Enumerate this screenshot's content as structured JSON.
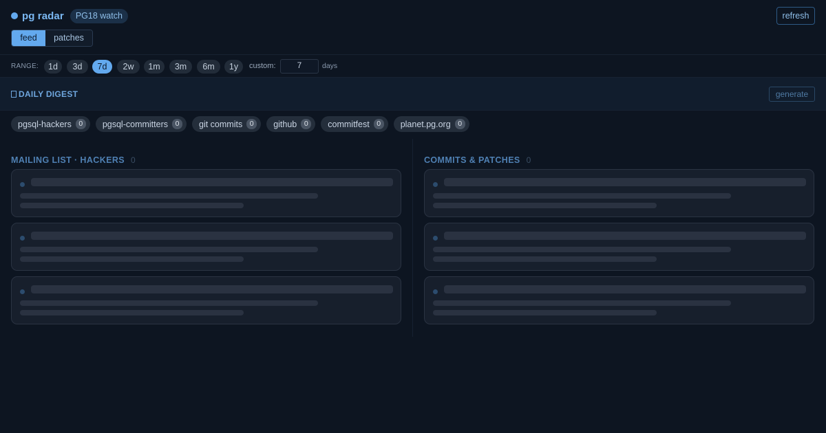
{
  "header": {
    "title": "pg radar",
    "badge": "PG18 watch",
    "refresh_label": "refresh",
    "tabs": [
      {
        "label": "feed",
        "active": true
      },
      {
        "label": "patches",
        "active": false
      }
    ]
  },
  "range": {
    "label": "RANGE:",
    "options": [
      {
        "label": "1d",
        "active": false
      },
      {
        "label": "3d",
        "active": false
      },
      {
        "label": "7d",
        "active": true
      },
      {
        "label": "2w",
        "active": false
      },
      {
        "label": "1m",
        "active": false
      },
      {
        "label": "3m",
        "active": false
      },
      {
        "label": "6m",
        "active": false
      },
      {
        "label": "1y",
        "active": false
      }
    ],
    "custom_label": "custom:",
    "custom_value": "7",
    "days_label": "days"
  },
  "digest": {
    "title": "DAILY DIGEST",
    "generate_label": "generate"
  },
  "sources": [
    {
      "name": "pgsql-hackers",
      "count": "0"
    },
    {
      "name": "pgsql-committers",
      "count": "0"
    },
    {
      "name": "git commits",
      "count": "0"
    },
    {
      "name": "github",
      "count": "0"
    },
    {
      "name": "commitfest",
      "count": "0"
    },
    {
      "name": "planet.pg.org",
      "count": "0"
    }
  ],
  "columns": {
    "left": {
      "title": "MAILING LIST · HACKERS",
      "count": "0"
    },
    "right": {
      "title": "COMMITS & PATCHES",
      "count": "0"
    }
  },
  "colors": {
    "accent": "#63a9ee",
    "background": "#0d1521",
    "card": "#171f2c"
  }
}
